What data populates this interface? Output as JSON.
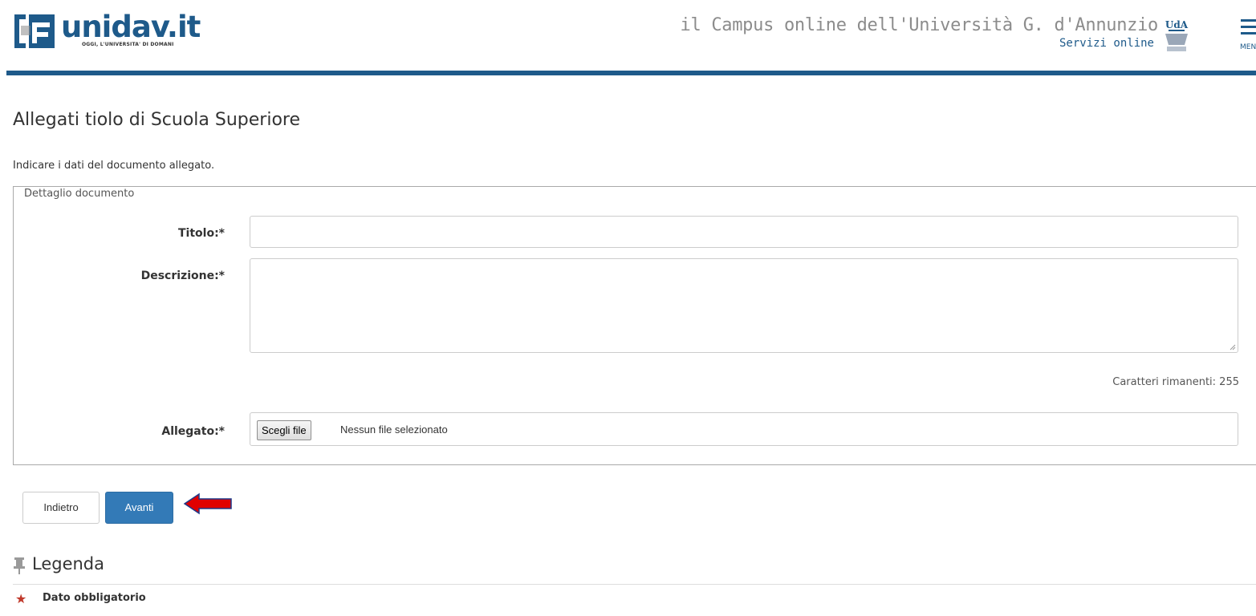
{
  "header": {
    "logo_text": "unidav.it",
    "logo_tagline": "OGGI, L'UNIVERSITA' DI DOMANI",
    "campus_title": "il Campus online dell'Università G. d'Annunzio",
    "campus_subtitle": "Servizi online",
    "uda_logo_text": "UdA",
    "menu_label": "MENU",
    "accent_color": "#1e5a8a"
  },
  "page": {
    "title": "Allegati tiolo di Scuola Superiore",
    "intro": "Indicare i dati del documento allegato."
  },
  "form": {
    "fieldset_legend": "Dettaglio documento",
    "titolo_label": "Titolo:*",
    "titolo_value": "",
    "descrizione_label": "Descrizione:*",
    "descrizione_value": "",
    "char_counter": "Caratteri rimanenti: 255",
    "allegato_label": "Allegato:*",
    "file_button": "Scegli file",
    "file_status": "Nessun file selezionato"
  },
  "actions": {
    "back_label": "Indietro",
    "next_label": "Avanti",
    "primary_color": "#337ab7",
    "arrow_color": "#e00000"
  },
  "legend": {
    "title": "Legenda",
    "items": [
      {
        "icon": "star-icon",
        "label": "Dato obbligatorio"
      }
    ]
  }
}
